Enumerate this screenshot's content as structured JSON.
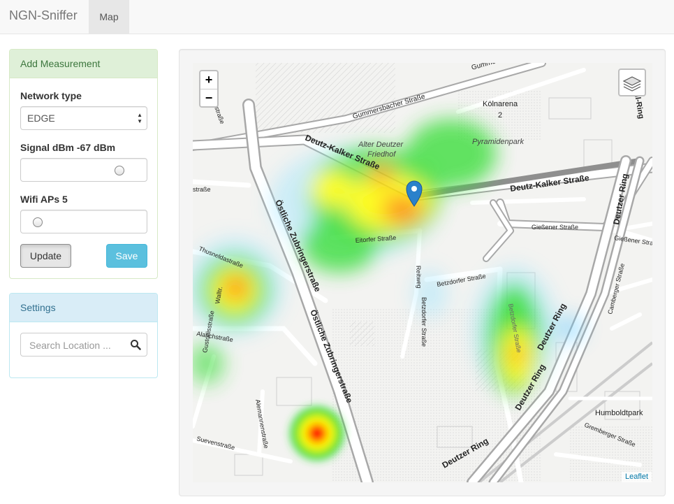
{
  "navbar": {
    "brand": "NGN-Sniffer",
    "tab_map": "Map"
  },
  "measurement": {
    "title": "Add Measurement",
    "network_label": "Network type",
    "network_value": "EDGE",
    "signal_label": "Signal dBm -67 dBm",
    "signal_level": 0.85,
    "wifi_label": "Wifi APs 5",
    "wifi_level": 0.05,
    "update_label": "Update",
    "save_label": "Save"
  },
  "settings": {
    "title": "Settings",
    "search_placeholder": "Search Location ..."
  },
  "map": {
    "zoom_in": "+",
    "zoom_out": "−",
    "attribution": "Leaflet",
    "labels": {
      "gummersbacher": "Gummersbacher Straße",
      "koelnarena": "Kölnarena",
      "koelnarena_num": "2",
      "deutz_kalker_1": "Deutz-Kalker Straße",
      "deutz_kalker_2": "Deutz-Kalker Straße",
      "alter_deutzer": "Alter Deutzer",
      "friedhof": "Friedhof",
      "pyramidenpark": "Pyramidenpark",
      "eitorfer": "Eitorfer Straße",
      "giessener_1": "Gießener Straße",
      "giessener_2": "Gießener Straße",
      "betzdorfer_1": "Betzdorfer Straße",
      "betzdorfer_2": "Betzdorfer Straße",
      "betzdorfer_3": "Betzdorfer Straße",
      "reitweg": "Reitweg",
      "oestliche_1": "Östliche Zubringerstraße",
      "oestliche_2": "Östliche Zubringerstraße",
      "deutzer_ring_1": "Deutzer Ring",
      "deutzer_ring_2": "Deutzer Ring",
      "deutzer_ring_3": "Deutzer Ring",
      "deutzer_ring_4": "Deutzer Ring",
      "thusnelda": "Thusneldastraße",
      "walltr": "Walltr.",
      "alarich": "Alarichstraße",
      "gustodis": "Gustodisstraße",
      "alemannen": "Alemannenstraße",
      "sueven": "Suevenstraße",
      "humboldtpark": "Humboldtpark",
      "gremberger": "Gremberger Straße",
      "camberger": "Camberger Straße",
      "ull_ring": "ull-Ring",
      "tinstrasse": "tinstraße",
      "str_frag": "straße"
    },
    "colors": {
      "hot": "#ff0000",
      "warm": "#ffff00",
      "cool": "#33dd33",
      "cold": "#66ccff"
    }
  }
}
